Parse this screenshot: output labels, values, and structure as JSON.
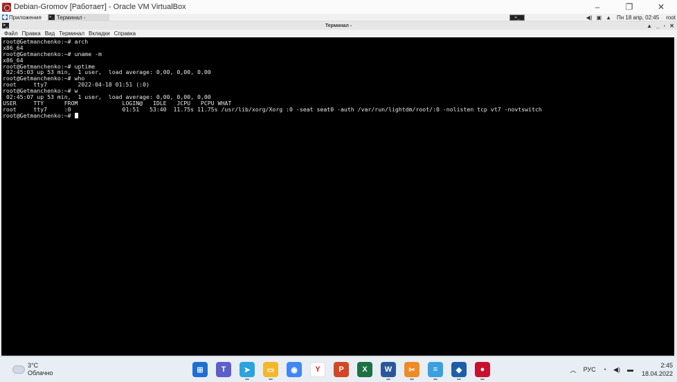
{
  "host_window": {
    "title": "Debian-Gromov [Работает] - Oracle VM VirtualBox",
    "minimize_icon": "minimize-icon",
    "restore_icon": "restore-icon",
    "close_icon": "close-icon"
  },
  "guest_panel": {
    "apps_label": "Приложения",
    "task_label": "Терминал -",
    "clock": "Пн 18 апр, 02:45",
    "user": "root"
  },
  "terminal": {
    "title": "Терминал -",
    "menu": [
      "Файл",
      "Правка",
      "Вид",
      "Терминал",
      "Вкладки",
      "Справка"
    ],
    "lines": [
      "root@Getmanchenko:~# arch",
      "x86_64",
      "root@Getmanchenko:~# uname -m",
      "x86_64",
      "root@Getmanchenko:~# uptime",
      " 02:45:03 up 53 min,  1 user,  load average: 0,00, 0,00, 0,00",
      "root@Getmanchenko:~# who",
      "root     tty7         2022-04-18 01:51 (:0)",
      "root@Getmanchenko:~# w",
      " 02:45:07 up 53 min,  1 user,  load average: 0,00, 0,00, 0,00",
      "USER     TTY      FROM             LOGIN@   IDLE   JCPU   PCPU WHAT",
      "root     tty7     :0               01:51   53:40  11.75s 11.75s /usr/lib/xorg/Xorg :0 -seat seat0 -auth /var/run/lightdm/root/:0 -nolisten tcp vt7 -novtswitch"
    ],
    "prompt": "root@Getmanchenko:~# "
  },
  "taskbar": {
    "weather_temp": "3°C",
    "weather_desc": "Облачно",
    "apps": [
      {
        "name": "windows-start-icon",
        "color": "#1f6fd0",
        "glyph": "⊞"
      },
      {
        "name": "teams-icon",
        "color": "#5b5fc7",
        "glyph": "T"
      },
      {
        "name": "telegram-icon",
        "color": "#2aa3de",
        "glyph": "➤"
      },
      {
        "name": "file-explorer-icon",
        "color": "#f2b72c",
        "glyph": "▭"
      },
      {
        "name": "chrome-icon",
        "color": "#4285f4",
        "glyph": "◉"
      },
      {
        "name": "yandex-browser-icon",
        "color": "#ffffff",
        "glyph": "Y"
      },
      {
        "name": "powerpoint-icon",
        "color": "#d24726",
        "glyph": "P"
      },
      {
        "name": "excel-icon",
        "color": "#1d7044",
        "glyph": "X"
      },
      {
        "name": "word-icon",
        "color": "#2b579a",
        "glyph": "W"
      },
      {
        "name": "snip-tool-icon",
        "color": "#f08a24",
        "glyph": "✂"
      },
      {
        "name": "notepad-icon",
        "color": "#3aa0e0",
        "glyph": "≡"
      },
      {
        "name": "virtualbox-icon",
        "color": "#1c5fa8",
        "glyph": "◆"
      },
      {
        "name": "debian-vm-icon",
        "color": "#c8102e",
        "glyph": "●"
      }
    ],
    "lang": "РУС",
    "time": "2:45",
    "date": "18.04.2022"
  }
}
